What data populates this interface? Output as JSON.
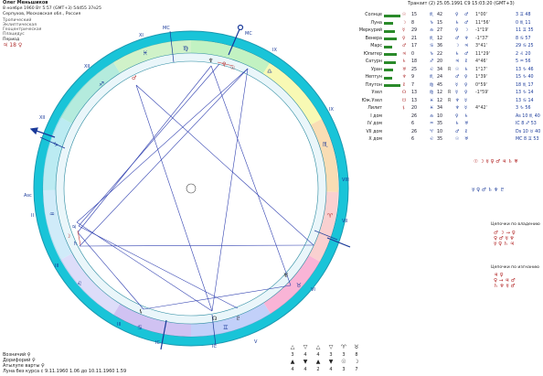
{
  "header": {
    "name": "Олег Меньшиков",
    "date_line": "8 ноября 1960  Вт  5:57 (GMT+3) 54d55  37e25",
    "place_line": "Серпухов, Московская обл., Россия",
    "lines": [
      "Тропический",
      "Эклиптическая",
      "Геоцентрическая",
      "Плацидус"
    ],
    "period_label": "Период",
    "period_value": "♃ 18 ♀"
  },
  "transit": "Транзит (2) 25.05.1991  С9 15:03:20 (GMT+3)",
  "planet_table": {
    "rows": [
      {
        "name": "Солнце",
        "bar": 18,
        "glyph": "☉",
        "deg": "15",
        "sign": "♏",
        "min": "42",
        "r": "",
        "c1": "♀",
        "c2": "♂",
        "c3": "1°00'",
        "t": "3 ♊ 48"
      },
      {
        "name": "Луна",
        "bar": 10,
        "glyph": "☽",
        "deg": "8",
        "sign": "♑",
        "min": "15",
        "r": "",
        "c1": "♄",
        "c2": "♂",
        "c3": "11°56'",
        "t": "0 ♏ 11"
      },
      {
        "name": "Меркурий",
        "bar": 12,
        "glyph": "☿",
        "deg": "29",
        "sign": "♎",
        "min": "27",
        "r": "",
        "c1": "♀",
        "c2": "☽",
        "c3": "-1°19'",
        "t": "11 ♊ 35"
      },
      {
        "name": "Венера",
        "bar": 14,
        "glyph": "♀",
        "deg": "21",
        "sign": "♏",
        "min": "12",
        "r": "",
        "c1": "♂",
        "c2": "♆",
        "c3": "-1°37'",
        "t": "8 ♋ 57"
      },
      {
        "name": "Марс",
        "bar": 9,
        "glyph": "♂",
        "deg": "17",
        "sign": "♋",
        "min": "36",
        "r": "",
        "c1": "☽",
        "c2": "♃",
        "c3": "3°41'",
        "t": "29 ♋ 25"
      },
      {
        "name": "Юпитер",
        "bar": 14,
        "glyph": "♃",
        "deg": "0",
        "sign": "♑",
        "min": "22",
        "r": "",
        "c1": "♄",
        "c2": "♂",
        "c3": "11°29'",
        "t": "2 ♌ 20"
      },
      {
        "name": "Сатурн",
        "bar": 13,
        "glyph": "♄",
        "deg": "18",
        "sign": "♐",
        "min": "20",
        "r": "",
        "c1": "♃",
        "c2": "♇",
        "c3": "4°46'",
        "t": "5 ♒ 56"
      },
      {
        "name": "Уран",
        "bar": 10,
        "glyph": "♅",
        "deg": "25",
        "sign": "♌",
        "min": "34",
        "r": "R",
        "c1": "☉",
        "c2": "♄",
        "c3": "1°17'",
        "t": "13 ♑ 46"
      },
      {
        "name": "Нептун",
        "bar": 9,
        "glyph": "♆",
        "deg": "9",
        "sign": "♏",
        "min": "24",
        "r": "",
        "c1": "♂",
        "c2": "♀",
        "c3": "1°39'",
        "t": "15 ♑ 40"
      },
      {
        "name": "Плутон",
        "bar": 18,
        "glyph": "♇",
        "deg": "7",
        "sign": "♍",
        "min": "45",
        "r": "",
        "c1": "☿",
        "c2": "♀",
        "c3": "0°59'",
        "t": "18 ♏ 17"
      },
      {
        "name": "Узел",
        "bar": 0,
        "glyph": "☊",
        "deg": "13",
        "sign": "♍",
        "min": "12",
        "r": "R",
        "c1": "☿",
        "c2": "♀",
        "c3": "-1°59'",
        "t": "13 ♑ 14"
      },
      {
        "name": "Юж.Узел",
        "bar": 0,
        "glyph": "☋",
        "deg": "13",
        "sign": "♓",
        "min": "12",
        "r": "R",
        "c1": "♆",
        "c2": "☿",
        "c3": "",
        "t": "13 ♋ 14"
      },
      {
        "name": "Лилит",
        "bar": 0,
        "glyph": "⚸",
        "deg": "20",
        "sign": "♓",
        "min": "34",
        "r": "",
        "c1": "♆",
        "c2": "☿",
        "c3": "4°42'",
        "t": "3 ♑ 56"
      },
      {
        "name": "I дом",
        "bar": 0,
        "glyph": "",
        "deg": "26",
        "sign": "♎",
        "min": "10",
        "r": "",
        "c1": "♀",
        "c2": "♄",
        "c3": "",
        "t": "As 10 ♏ 40"
      },
      {
        "name": "IV дом",
        "bar": 0,
        "glyph": "",
        "deg": "6",
        "sign": "♒",
        "min": "35",
        "r": "",
        "c1": "♄",
        "c2": "♅",
        "c3": "",
        "t": "IC 8 ♐ 53"
      },
      {
        "name": "VII дом",
        "bar": 0,
        "glyph": "",
        "deg": "26",
        "sign": "♈",
        "min": "10",
        "r": "",
        "c1": "♂",
        "c2": "♇",
        "c3": "",
        "t": "Ds 10 ♉ 40"
      },
      {
        "name": "X дом",
        "bar": 0,
        "glyph": "",
        "deg": "6",
        "sign": "♌",
        "min": "35",
        "r": "",
        "c1": "☉",
        "c2": "♅",
        "c3": "",
        "t": "MC 8 ♊ 53"
      }
    ]
  },
  "chains": {
    "title1": "Цепочки по владению",
    "title2": "Цепочки по изгнанию"
  },
  "footer": {
    "l1": "Возничий  ♀",
    "l2": "Дорифорий  ♀",
    "l3": "Атылупе варты  ♀",
    "l4": "Луна без курса с 9.11.1960  1.06 до 10.11.1960  1.59"
  },
  "bottom_icons": {
    "row1": [
      "3",
      "4",
      "4",
      "3",
      "3",
      "8"
    ],
    "row2": [
      "4",
      "4",
      "2",
      "4",
      "3",
      "7"
    ]
  },
  "colors": {
    "outer_ring": "#19c4d8",
    "aspect_blue": "#3040b0",
    "aspect_red": "#c03030"
  }
}
